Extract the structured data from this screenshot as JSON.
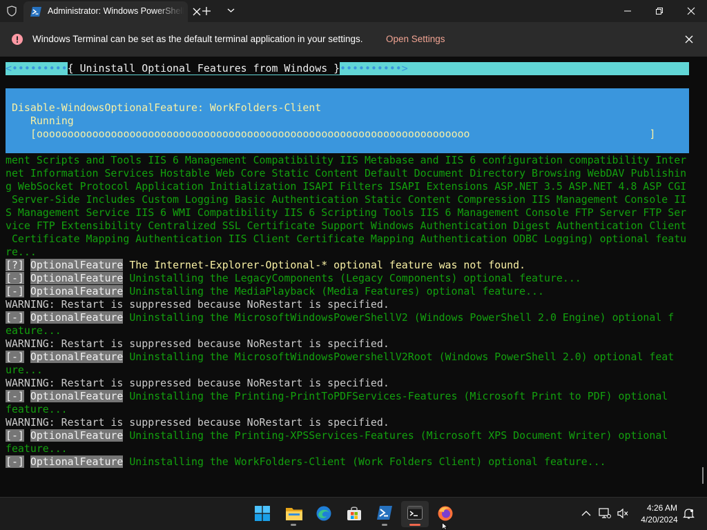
{
  "window": {
    "tab_title": "Administrator: Windows PowerShell"
  },
  "infobar": {
    "message": "Windows Terminal can be set as the default terminal application in your settings.",
    "link_label": "Open Settings"
  },
  "terminal": {
    "header": {
      "left": "<•••••••••",
      "title": "{ Uninstall Optional Features from Windows }",
      "right": "••••••••••>"
    },
    "progress": {
      "activity": "Disable-WindowsOptionalFeature: WorkFolders-Client",
      "status": "Running",
      "bar": "[oooooooooooooooooooooooooooooooooooooooooooooooooooooooooooooooooooooo                             ]"
    },
    "wrapped_lines": [
      "ment Scripts and Tools IIS 6 Management Compatibility IIS Metabase and IIS 6 configuration compatibility Inter",
      "net Information Services Hostable Web Core Static Content Default Document Directory Browsing WebDAV Publishin",
      "g WebSocket Protocol Application Initialization ISAPI Filters ISAPI Extensions ASP.NET 3.5 ASP.NET 4.8 ASP CGI",
      " Server-Side Includes Custom Logging Basic Authentication Static Content Compression IIS Management Console II",
      "S Management Service IIS 6 WMI Compatibility IIS 6 Scripting Tools IIS 6 Management Console FTP Server FTP Ser",
      "vice FTP Extensibility Centralized SSL Certificate Support Windows Authentication Digest Authentication Client",
      " Certificate Mapping Authentication IIS Client Certificate Mapping Authentication ODBC Logging) optional featu",
      "re..."
    ],
    "tag_label": "OptionalFeature",
    "not_found_marker": "[?]",
    "uninstall_marker": "[-]",
    "not_found_msg": " The Internet-Explorer-Optional-* optional feature was not found.",
    "warning": "WARNING: Restart is suppressed because NoRestart is specified.",
    "msg_legacy": " Uninstalling the LegacyComponents (Legacy Components) optional feature...",
    "msg_media": " Uninstalling the MediaPlayback (Media Features) optional feature...",
    "msg_ps2_a": " Uninstalling the MicrosoftWindowsPowerShellV2 (Windows PowerShell 2.0 Engine) optional f",
    "msg_ps2_b": "eature...",
    "msg_ps2root_a": " Uninstalling the MicrosoftWindowsPowershellV2Root (Windows PowerShell 2.0) optional feat",
    "msg_ps2root_b": "ure...",
    "msg_pdf_a": " Uninstalling the Printing-PrintToPDFServices-Features (Microsoft Print to PDF) optional",
    "msg_pdf_b": "feature...",
    "msg_xps_a": " Uninstalling the Printing-XPSServices-Features (Microsoft XPS Document Writer) optional",
    "msg_xps_b": "feature...",
    "msg_work": " Uninstalling the WorkFolders-Client (Work Folders Client) optional feature..."
  },
  "taskbar": {
    "time": "4:26 AM",
    "date": "4/20/2024"
  }
}
